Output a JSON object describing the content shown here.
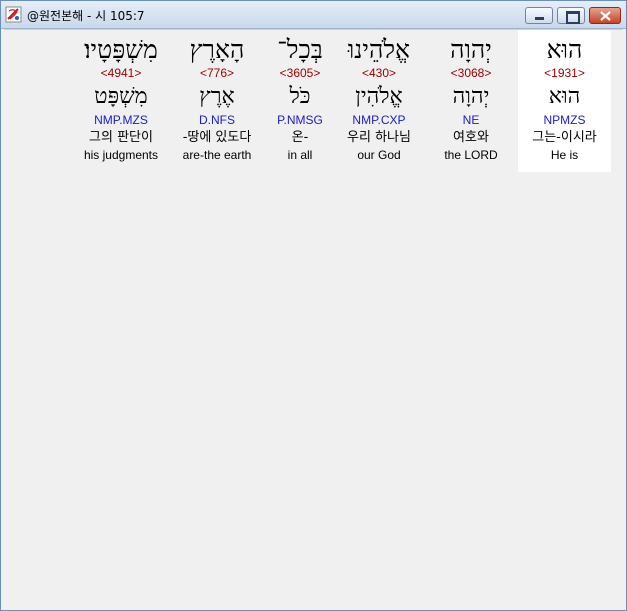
{
  "window": {
    "title": "@원전본해 - 시 105:7",
    "accent_color": "#c1442a"
  },
  "words": [
    {
      "hebrew": "מִשְׁפָּטָיו׃",
      "strong": "<4941>",
      "lexeme": "מִשְׁפָּט",
      "morph": "NMP.MZS",
      "korean": "그의 판단이",
      "english": "his judgments",
      "highlighted": false
    },
    {
      "hebrew": "הָאָרֶץ",
      "strong": "<776>",
      "lexeme": "אֶרֶץ",
      "morph": "D.NFS",
      "korean": "-땅에 있도다",
      "english": "are-the earth",
      "highlighted": false
    },
    {
      "hebrew": "בְּכָל־",
      "strong": "<3605>",
      "lexeme": "כֹּל",
      "morph": "P.NMSG",
      "korean": "온-",
      "english": "in all",
      "highlighted": false
    },
    {
      "hebrew": "אֱלֹהֵינוּ",
      "strong": "<430>",
      "lexeme": "אֱלֹהִין",
      "morph": "NMP.CXP",
      "korean": "우리 하나님",
      "english": "our God",
      "highlighted": false
    },
    {
      "hebrew": "יְהוָה",
      "strong": "<3068>",
      "lexeme": "יְהוָה",
      "morph": "NE",
      "korean": "여호와",
      "english": "the LORD",
      "highlighted": false
    },
    {
      "hebrew": "הוּא",
      "strong": "<1931>",
      "lexeme": "הוּא",
      "morph": "NPMZS",
      "korean": "그는-이시라",
      "english": "He is",
      "highlighted": true
    }
  ]
}
